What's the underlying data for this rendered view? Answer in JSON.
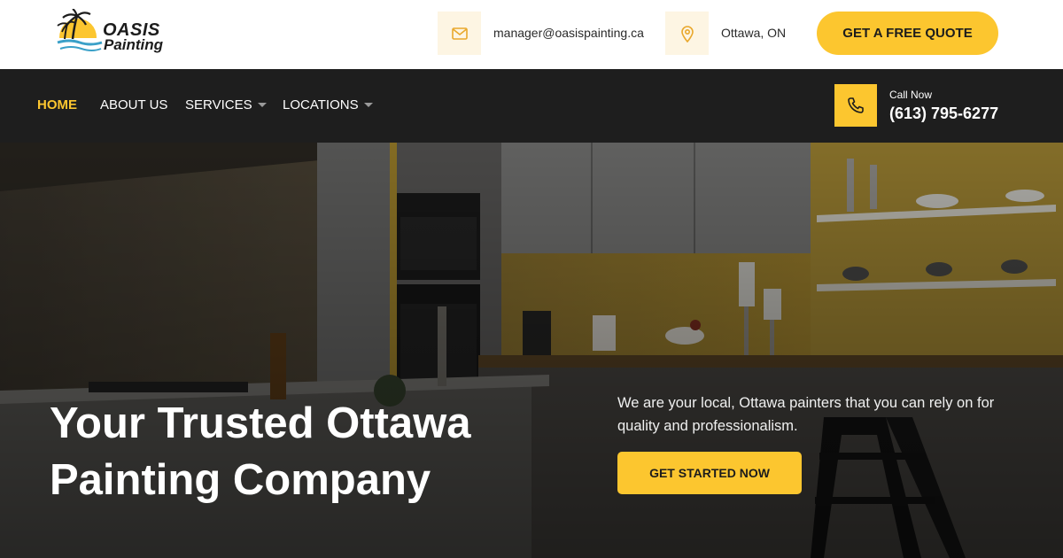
{
  "brand": {
    "line1": "OASIS",
    "line2": "Painting"
  },
  "topbar": {
    "email": "manager@oasispainting.ca",
    "email_icon": "envelope-icon",
    "location": "Ottawa, ON",
    "location_icon": "map-pin-icon",
    "quote_button": "GET A FREE QUOTE"
  },
  "nav": {
    "items": [
      {
        "label": "HOME",
        "active": true
      },
      {
        "label": "ABOUT US"
      },
      {
        "label": "SERVICES",
        "dropdown": true
      },
      {
        "label": "LOCATIONS",
        "dropdown": true
      }
    ],
    "call_label": "Call Now",
    "call_number": "(613) 795-6277",
    "call_icon": "phone-icon"
  },
  "hero": {
    "title_line1": "Your Trusted Ottawa",
    "title_line2": "Painting Company",
    "description": "We are your local, Ottawa painters that you can rely on for quality and professionalism.",
    "cta": "GET STARTED NOW"
  },
  "colors": {
    "accent": "#fcc62f",
    "nav_bg": "#1e1e1e",
    "icon_bg": "#fdf5e3"
  }
}
